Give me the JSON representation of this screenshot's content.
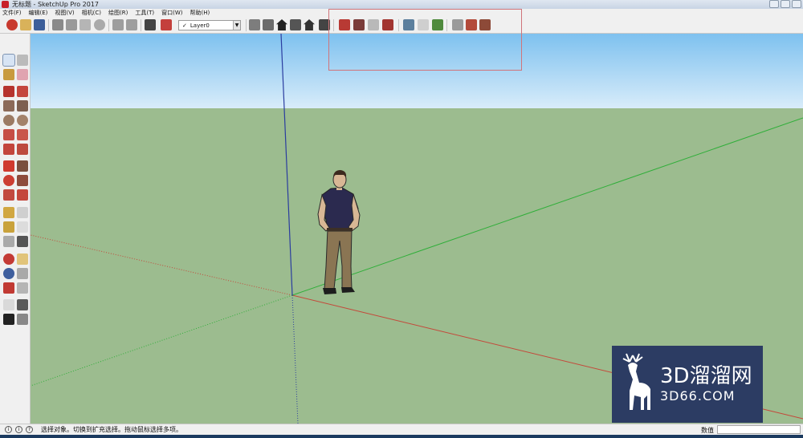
{
  "window": {
    "title": "无标题 - SketchUp Pro 2017"
  },
  "menu": [
    "文件(F)",
    "编辑(E)",
    "视图(V)",
    "相机(C)",
    "绘图(R)",
    "工具(T)",
    "窗口(W)",
    "帮助(H)"
  ],
  "toolbar": {
    "layer_current": "Layer0",
    "layer_check": "✓"
  },
  "statusbar": {
    "message": "选择对象。切换到扩充选择。拖动鼠标选择多项。",
    "value_label": "数值",
    "value": ""
  },
  "watermark": {
    "main": "3D溜溜网",
    "sub": "3D66.COM"
  },
  "colors": {
    "sky_top": "#7ec1ef",
    "ground": "#9cbc8f",
    "axis_red": "#c4483a",
    "axis_green": "#2fae39",
    "axis_blue": "#2a3c9f",
    "highlight": "#d0747a",
    "watermark_bg": "#2c3c63"
  }
}
